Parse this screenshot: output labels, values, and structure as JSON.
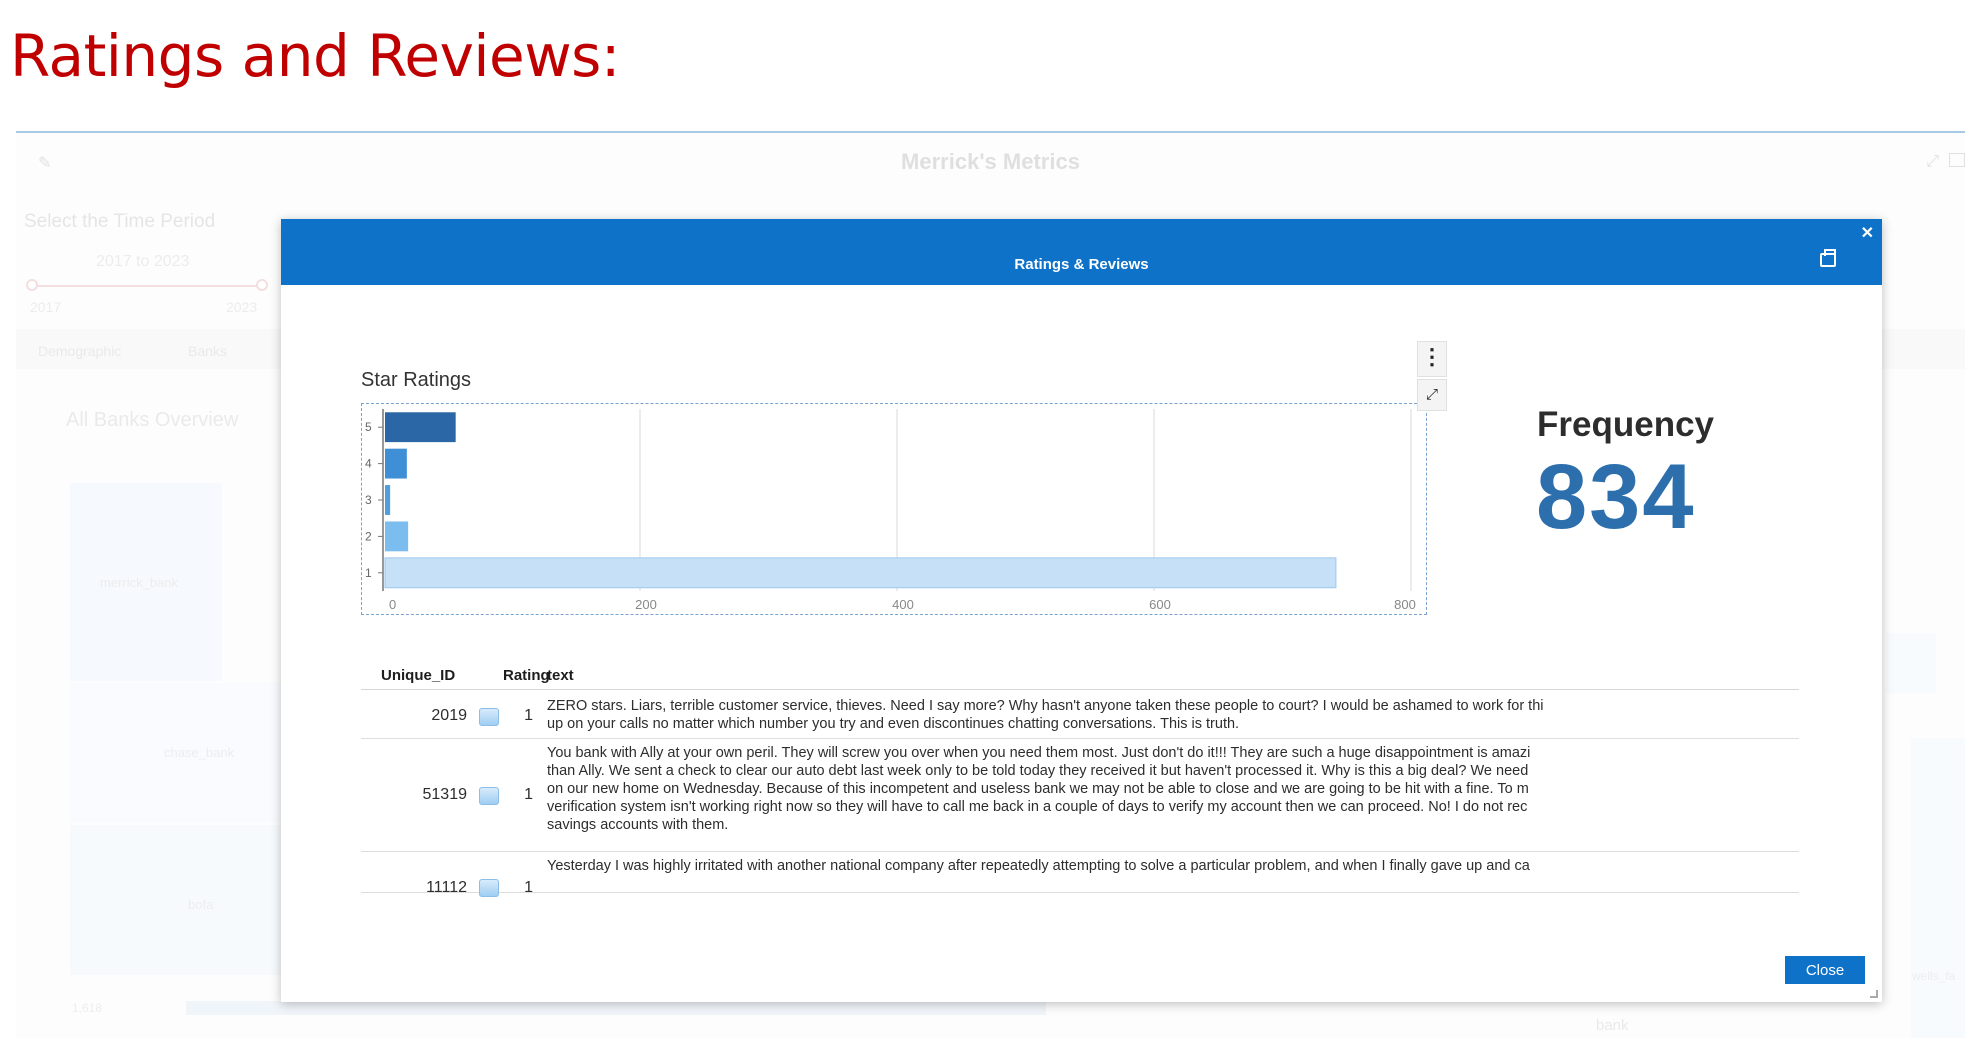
{
  "slide": {
    "heading": "Ratings and Reviews:"
  },
  "background": {
    "title": "Merrick's Metrics",
    "filter_label": "Select the Time Period",
    "filter_value": "2017 to 2023",
    "slider_min": "2017",
    "slider_max": "2023",
    "tabs": [
      "Demographic",
      "Banks"
    ],
    "overview_title": "All Banks Overview",
    "bank_labels": [
      "merrick_bank",
      "chase_bank",
      "bofa"
    ],
    "axis_value": "1,618",
    "bottom_label": "bank",
    "right_label": "wells_fa"
  },
  "modal": {
    "title": "Ratings & Reviews",
    "close_label": "Close",
    "chart_title": "Star Ratings",
    "kpi_label": "Frequency",
    "kpi_value": "834"
  },
  "chart_data": {
    "type": "bar",
    "orientation": "horizontal",
    "title": "Star Ratings",
    "categories": [
      "5",
      "4",
      "3",
      "2",
      "1"
    ],
    "values": [
      55,
      17,
      4,
      18,
      740
    ],
    "colors": [
      "#2b67a6",
      "#3f8fd6",
      "#4f9fe0",
      "#7cbdf0",
      "#c6e0f7"
    ],
    "x_ticks": [
      0,
      200,
      400,
      600,
      800
    ],
    "xlim": [
      0,
      800
    ],
    "xlabel": "",
    "ylabel": "",
    "grid": true
  },
  "table": {
    "columns": {
      "id": "Unique_ID",
      "rating": "Rating",
      "text": "text"
    },
    "rows": [
      {
        "id": "2019",
        "rating": "1",
        "text": "ZERO stars. Liars, terrible customer service, thieves. Need I say more? Why hasn't anyone taken these people to court? I would be ashamed to work for thi\nup on your calls no matter which number you try and even discontinues chatting conversations. This is truth."
      },
      {
        "id": "51319",
        "rating": "1",
        "text": "You bank with Ally at your own peril. They will screw you over when you need them most. Just don't do it!!! They are such a huge disappointment is amazi\nthan Ally. We sent a check to clear our auto debt last week only to be told today they received it but haven't processed it. Why is this a big deal? We need\non our new home on Wednesday. Because of this incompetent and useless bank we may not be able to close and we are going to be hit with a fine. To m\nverification system isn't working right now so they will have to call me back in a couple of days to verify my account then we can proceed. No! I do not rec\nsavings accounts with them."
      },
      {
        "id": "11112",
        "rating": "1",
        "text": "Yesterday I was highly irritated with another national company after repeatedly attempting to solve a particular problem, and when I finally gave up and ca"
      }
    ]
  },
  "icons": {
    "close": "close-icon",
    "print": "print-icon",
    "menu": "kebab-menu-icon",
    "expand": "expand-icon",
    "edit": "pencil-icon"
  }
}
